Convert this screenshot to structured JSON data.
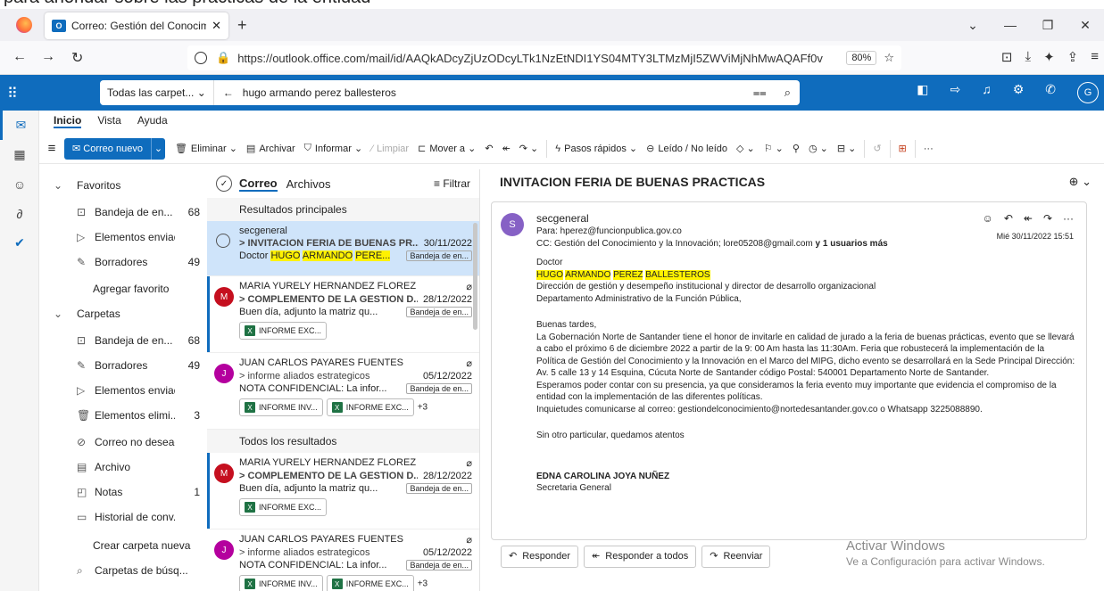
{
  "top_strip": "para ahondar sobre las prácticas de la entidad",
  "browser": {
    "tab_title": "Correo: Gestión del Conocimien",
    "url": "https://outlook.office.com/mail/id/AAQkADcyZjUzODcyLTk1NzEtNDI1YS04MTY3LTMzMjI5ZWViMjNhMwAQAFf0v",
    "zoom": "80%"
  },
  "header": {
    "search_scope": "Todas las carpet...",
    "search_query": "hugo armando perez ballesteros",
    "avatar_initial": "G"
  },
  "ribbon": {
    "tabs": [
      "Inicio",
      "Vista",
      "Ayuda"
    ],
    "new_mail": "Correo nuevo",
    "buttons": [
      "Eliminar",
      "Archivar",
      "Informar",
      "Limpiar",
      "Mover a",
      "Pasos rápidos",
      "Leído / No leído"
    ]
  },
  "folders": {
    "favorites_label": "Favoritos",
    "favorites": [
      {
        "label": "Bandeja de en...",
        "count": "68"
      },
      {
        "label": "Elementos enviad...",
        "count": ""
      },
      {
        "label": "Borradores",
        "count": "49"
      }
    ],
    "add_favorite": "Agregar favorito",
    "folders_label": "Carpetas",
    "items": [
      {
        "label": "Bandeja de en...",
        "count": "68"
      },
      {
        "label": "Borradores",
        "count": "49"
      },
      {
        "label": "Elementos enviad...",
        "count": ""
      },
      {
        "label": "Elementos elimi...",
        "count": "3"
      },
      {
        "label": "Correo no deseado",
        "count": ""
      },
      {
        "label": "Archivo",
        "count": ""
      },
      {
        "label": "Notas",
        "count": "1"
      },
      {
        "label": "Historial de conv...",
        "count": ""
      }
    ],
    "create_folder": "Crear carpeta nueva",
    "search_folders": "Carpetas de búsq..."
  },
  "list": {
    "tab_mail": "Correo",
    "tab_files": "Archivos",
    "filter": "Filtrar",
    "section_top": "Resultados principales",
    "section_all": "Todos los resultados",
    "msg1": {
      "from": "secgeneral",
      "subject": "> INVITACION FERIA DE BUENAS PR...",
      "date": "30/11/2022",
      "preview_pre": "Doctor ",
      "preview_hl1": "HUGO",
      "preview_hl2": "ARMANDO",
      "preview_hl3": "PERE...",
      "tag": "Bandeja de en..."
    },
    "msg2": {
      "initial": "M",
      "from": "MARIA YURELY HERNANDEZ FLOREZ",
      "subject": "> COMPLEMENTO DE LA GESTION D...",
      "date": "28/12/2022",
      "preview": "Buen día, adjunto la matriz qu...",
      "tag": "Bandeja de en...",
      "att1": "INFORME EXC..."
    },
    "msg3": {
      "initial": "J",
      "from": "JUAN CARLOS PAYARES FUENTES",
      "subject": "> informe aliados estrategicos",
      "date": "05/12/2022",
      "preview": "NOTA CONFIDENCIAL: La infor...",
      "tag": "Bandeja de en...",
      "att1": "INFORME INV...",
      "att2": "INFORME EXC...",
      "more": "+3"
    },
    "msg4": {
      "initial": "M",
      "from": "MARIA YURELY HERNANDEZ FLOREZ",
      "subject": "> COMPLEMENTO DE LA GESTION D...",
      "date": "28/12/2022",
      "preview": "Buen día, adjunto la matriz qu...",
      "tag": "Bandeja de en...",
      "att1": "INFORME EXC..."
    },
    "msg5": {
      "initial": "J",
      "from": "JUAN CARLOS PAYARES FUENTES",
      "subject": "> informe aliados estrategicos",
      "date": "05/12/2022",
      "preview": "NOTA CONFIDENCIAL: La infor...",
      "tag": "Bandeja de en...",
      "att1": "INFORME INV...",
      "att2": "INFORME EXC...",
      "more": "+3"
    }
  },
  "reader": {
    "title": "INVITACION FERIA DE BUENAS PRACTICAS",
    "avatar": "S",
    "sender": "secgeneral",
    "to": "Para: hperez@funcionpublica.gov.co",
    "datetime": "Mié 30/11/2022 15:51",
    "cc": "CC: Gestión del Conocimiento y la Innovación;  lore05208@gmail.com",
    "cc_more": "y 1 usuarios más",
    "salutation": "Doctor",
    "name_hl1": "HUGO",
    "name_hl2": "ARMANDO",
    "name_hl3": "PEREZ",
    "name_hl4": "BALLESTEROS",
    "role1": "Dirección de gestión y desempeño institucional y director de desarrollo organizacional",
    "role2": "Departamento Administrativo de la Función Pública,",
    "greeting": "Buenas tardes,",
    "para1": "La Gobernación Norte de Santander tiene el honor de invitarle en calidad de jurado a la feria de buenas prácticas, evento que se llevará a cabo el próximo 6 de diciembre 2022  a partir de la 9: 00 Am hasta las 11:30Am. Feria que robustecerá la implementación de la Política de Gestión del Conocimiento y la Innovación en el Marco del MIPG, dicho evento se desarrollará en la Sede Principal Dirección: Av. 5 calle 13 y 14 Esquina, Cúcuta Norte de Santander código Postal: 540001 Departamento Norte de Santander.",
    "para2": "Esperamos poder contar con su presencia, ya que consideramos la feria evento muy importante que evidencia el compromiso de la entidad con la implementación de las diferentes políticas.",
    "para3": "Inquietudes comunicarse al correo: gestiondelconocimiento@nortedesantander.gov.co o Whatsapp 3225088890.",
    "closing": "Sin otro particular, quedamos atentos",
    "signer": "EDNA CAROLINA JOYA NUÑEZ",
    "signer_title": "Secretaria General",
    "reply": "Responder",
    "reply_all": "Responder a todos",
    "forward": "Reenviar"
  },
  "watermark": {
    "line1": "Activar Windows",
    "line2": "Ve a Configuración para activar Windows."
  },
  "colors": {
    "accent": "#0f6cbd",
    "highlight": "#fff200",
    "selected": "#cfe4fa"
  }
}
